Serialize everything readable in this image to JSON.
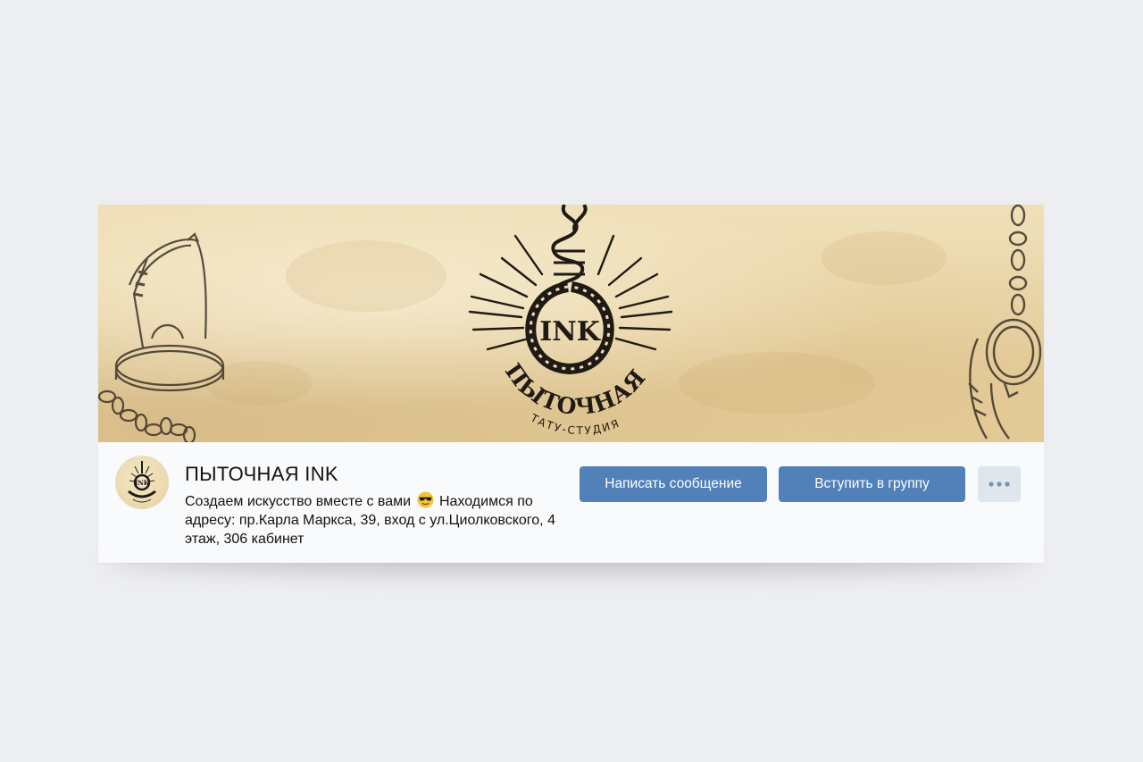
{
  "group": {
    "name": "ПЫТОЧНАЯ INK",
    "status_part1": "Создаем искусство вместе с вами",
    "status_part2": "Находимся по адресу: пр.Карла Маркса, 39, вход с ул.Циолковского, 4 этаж, 306 кабинет"
  },
  "cover": {
    "logo_letters": "INK",
    "logo_title": "ПЫТОЧНАЯ",
    "logo_subtitle": "ТАТУ-СТУДИЯ"
  },
  "actions": {
    "message_label": "Написать сообщение",
    "join_label": "Вступить в группу",
    "more_icon": "more-dots-icon"
  },
  "colors": {
    "button": "#5181b8",
    "more_button": "#dfe6ee",
    "page_bg": "#edeef2",
    "profile_bg": "#f9fafc"
  }
}
